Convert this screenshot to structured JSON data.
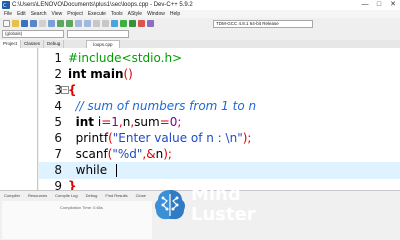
{
  "window": {
    "title": "C:\\Users\\LENOVO\\Documents\\plus1\\sec\\loops.cpp - Dev-C++ 5.9.2",
    "controls": [
      "—",
      "□",
      "✕"
    ]
  },
  "menu": [
    "File",
    "Edit",
    "Search",
    "View",
    "Project",
    "Execute",
    "Tools",
    "AStyle",
    "Window",
    "Help"
  ],
  "toolbar": {
    "compiler": "TDM-GCC 4.8.1 64-bit Release",
    "scope": "(globals)"
  },
  "tabs": {
    "project": "Project",
    "classes": "Classes",
    "debug": "Debug",
    "file": "loops.cpp"
  },
  "editor": {
    "lines": [
      {
        "num": "1",
        "text": "#include<stdio.h>"
      },
      {
        "num": "2",
        "text": "int main()"
      },
      {
        "num": "3",
        "text": "{"
      },
      {
        "num": "4",
        "text": "  // sum of numbers from 1 to n"
      },
      {
        "num": "5",
        "text": "  int i=1,n,sum=0;"
      },
      {
        "num": "6",
        "text": "  printf(\"Enter value of n : \\n\");"
      },
      {
        "num": "7",
        "text": "  scanf(\"%d\",&n);"
      },
      {
        "num": "8",
        "text": "  while"
      },
      {
        "num": "9",
        "text": "}"
      }
    ],
    "fold_symbol": "−"
  },
  "bottom": {
    "tabs": [
      "Compiler",
      "Resources",
      "Compile Log",
      "Debug",
      "Find Results",
      "Close"
    ],
    "compile_time": "Compilation Time: 0.66s"
  },
  "watermark": {
    "line1": "Mind",
    "line2": "Luster"
  },
  "colors": {
    "current_line": "#dff2ff",
    "preprocessor": "#00a000",
    "comment": "#1c6ad8",
    "number": "#7a00a0",
    "string": "#1e4ac8",
    "brace": "#e00000"
  }
}
